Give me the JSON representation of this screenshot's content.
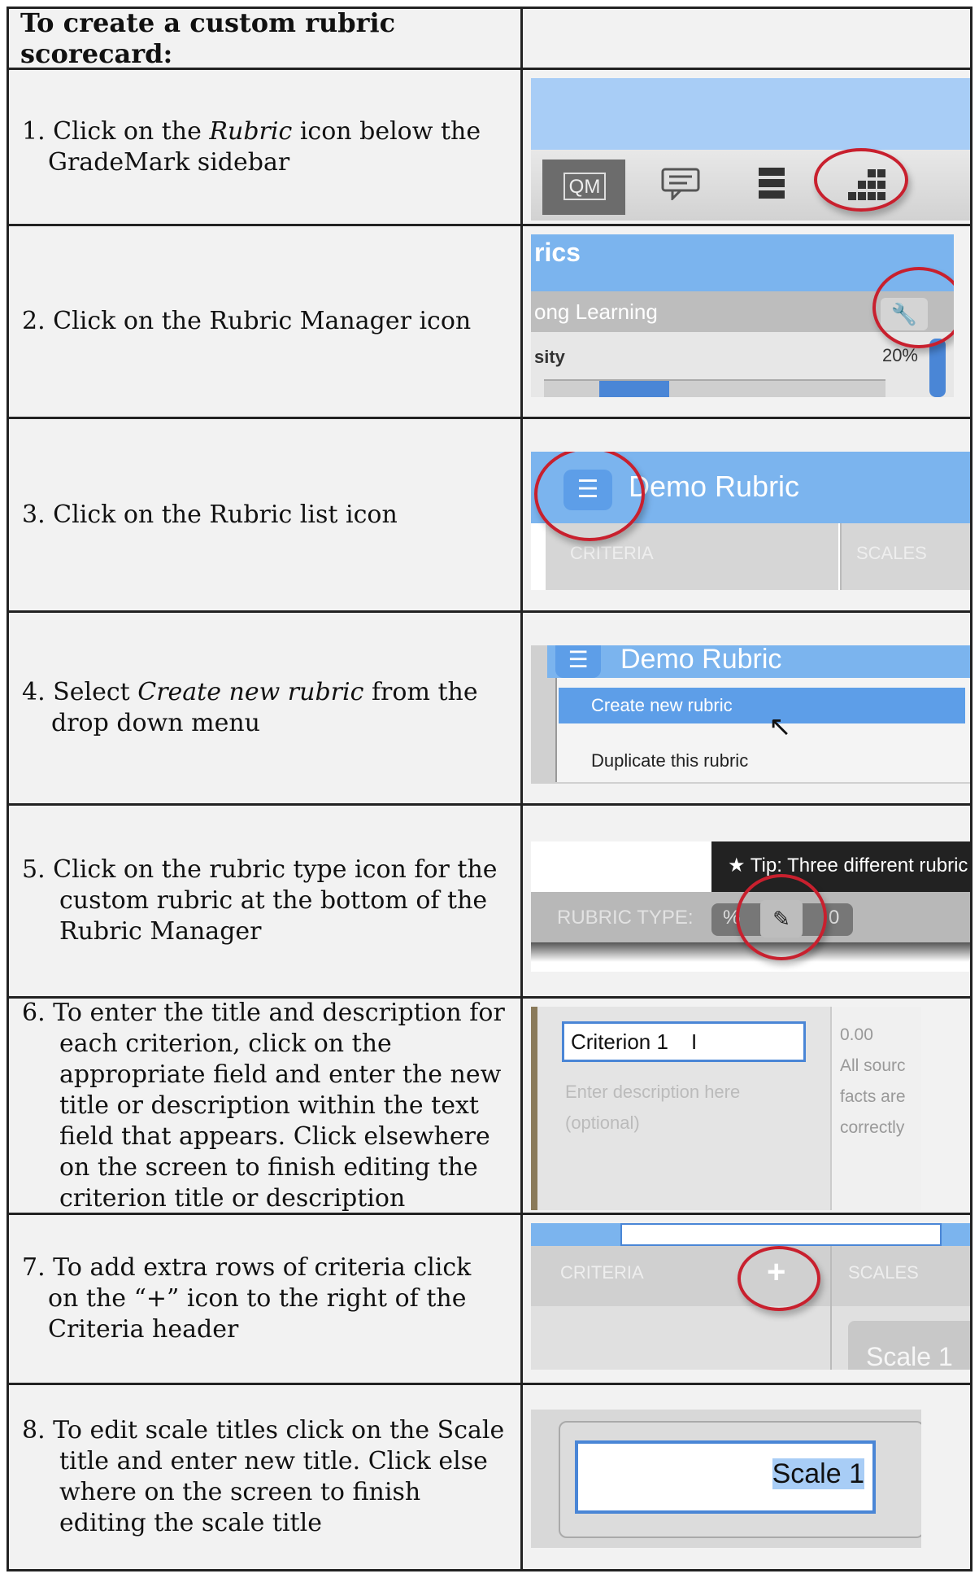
{
  "header": {
    "title": "To create a custom rubric scorecard:"
  },
  "steps": [
    {
      "num": "1.",
      "pre": "Click on the ",
      "em": "Rubric",
      "post": " icon below the GradeMark sidebar"
    },
    {
      "num": "2.",
      "text": "Click on the Rubric Manager icon"
    },
    {
      "num": "3.",
      "text": "Click on the Rubric list icon"
    },
    {
      "num": "4.",
      "pre": "Select ",
      "em": "Create new rubric",
      "post": " from the drop down menu"
    },
    {
      "num": "5.",
      "text": "Click on the rubric type icon for the custom rubric at the bottom of the Rubric Manager"
    },
    {
      "num": "6.",
      "text": "To enter the title and description for each criterion, click on the appropriate field and enter the new title or description within the text field that appears. Click elsewhere on the screen to finish editing the criterion title or description"
    },
    {
      "num": "7.",
      "text": "To add extra rows of criteria click on the “+” icon to the right of the Criteria header"
    },
    {
      "num": "8.",
      "text": "To edit scale titles click on the Scale title and enter new title. Click else where on the screen to finish editing the scale title"
    }
  ],
  "shots": {
    "s1": {
      "qm": "QM"
    },
    "s2": {
      "title": "rics",
      "subtitle": "ong Learning",
      "row_label": "sity",
      "row_pct": "20%"
    },
    "s3": {
      "title": "Demo Rubric",
      "criteria": "CRITERIA",
      "scales": "SCALES"
    },
    "s4": {
      "title": "Demo Rubric",
      "item1": "Create new rubric",
      "item2": "Duplicate this rubric"
    },
    "s5": {
      "tip": "Tip: Three different rubric",
      "label": "RUBRIC TYPE:",
      "pct": "%",
      "zero": "0"
    },
    "s6": {
      "input": "Criterion 1",
      "desc1": "Enter description here",
      "desc2": "(optional)",
      "score": "0.00",
      "r1": "All sourc",
      "r2": "facts are",
      "r3": "correctly"
    },
    "s7": {
      "criteria": "CRITERIA",
      "scales": "SCALES",
      "scale": "Scale 1"
    },
    "s8": {
      "scale": "Scale 1"
    }
  },
  "accent": {
    "circle": "#c8202e",
    "header_blue": "#7bb4ee",
    "button_blue": "#5d9ee8"
  }
}
